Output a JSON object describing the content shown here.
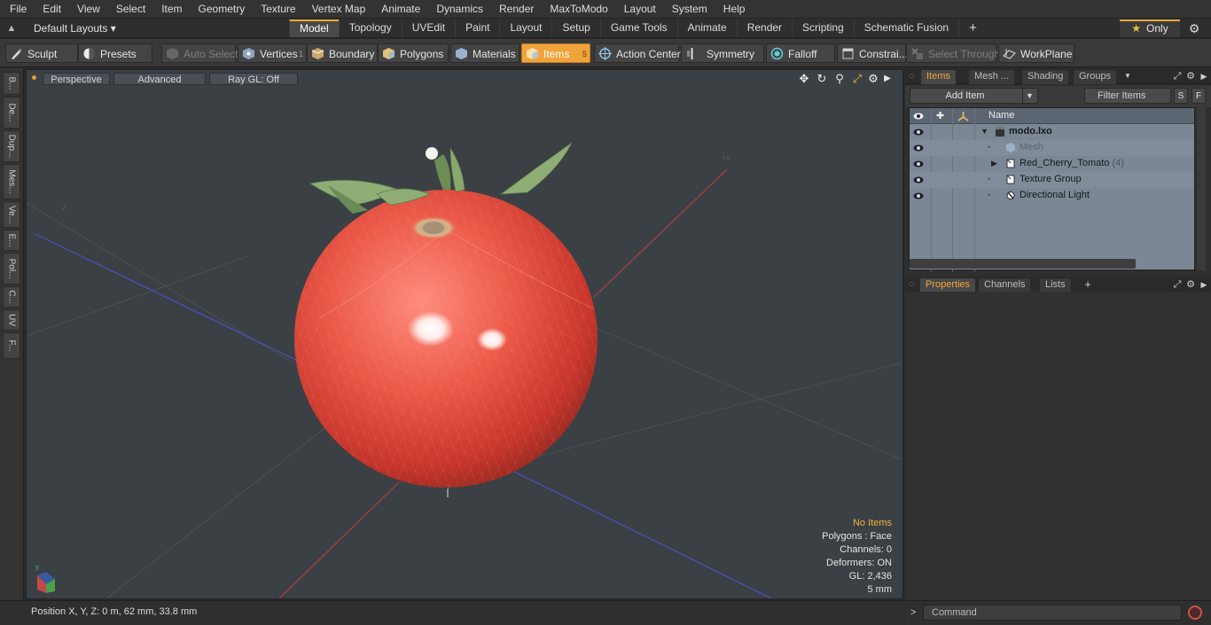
{
  "menu": [
    "File",
    "Edit",
    "View",
    "Select",
    "Item",
    "Geometry",
    "Texture",
    "Vertex Map",
    "Animate",
    "Dynamics",
    "Render",
    "MaxToModo",
    "Layout",
    "System",
    "Help"
  ],
  "layout": {
    "selected": "Default Layouts ▾"
  },
  "tabs": [
    "Model",
    "Topology",
    "UVEdit",
    "Paint",
    "Layout",
    "Setup",
    "Game Tools",
    "Animate",
    "Render",
    "Scripting",
    "Schematic Fusion"
  ],
  "active_tab": "Model",
  "only_label": "Only",
  "toolbar": {
    "sculpt": "Sculpt",
    "presets": "Presets",
    "auto_select": "Auto Select",
    "vertices": "Vertices",
    "vertices_count": "1",
    "boundary": "Boundary",
    "polygons": "Polygons",
    "materials": "Materials",
    "items": "Items",
    "items_count": "5",
    "action_center": "Action Center",
    "symmetry": "Symmetry",
    "falloff": "Falloff",
    "constraints": "Constrai...",
    "select_through": "Select Through",
    "workplane": "WorkPlane"
  },
  "left_tabs": [
    "B...",
    "De...",
    "Dup...",
    "Mes...",
    "Ve...",
    "E...",
    "Pol...",
    "C...",
    "UV",
    "F..."
  ],
  "viewport": {
    "view_mode": "Perspective",
    "shading": "Advanced",
    "raygl": "Ray GL: Off",
    "info": {
      "selection": "No Items",
      "polygons": "Polygons : Face",
      "channels": "Channels: 0",
      "deformers": "Deformers: ON",
      "gl": "GL: 2,436",
      "scale": "5 mm"
    }
  },
  "status": {
    "position": "Position X, Y, Z:   0 m, 62 mm, 33.8 mm"
  },
  "items_panel": {
    "tabs": [
      "Items",
      "Mesh ...",
      "Shading",
      "Groups"
    ],
    "add_item": "Add Item",
    "filter": "Filter Items",
    "s_label": "S",
    "f_label": "F",
    "name_header": "Name",
    "rows": [
      {
        "label": "modo.lxo",
        "count": ""
      },
      {
        "label": "Mesh",
        "count": ""
      },
      {
        "label": "Red_Cherry_Tomato",
        "count": "(4)"
      },
      {
        "label": "Texture Group",
        "count": ""
      },
      {
        "label": "Directional Light",
        "count": ""
      }
    ]
  },
  "props_panel": {
    "tabs": [
      "Properties",
      "Channels",
      "Lists"
    ]
  },
  "command": {
    "placeholder": "Command"
  },
  "colors": {
    "accent": "#f0a33a",
    "tomato": "#e85a4a",
    "viewport_bg": "#3b4045",
    "tree_bg": "#7b8795"
  }
}
